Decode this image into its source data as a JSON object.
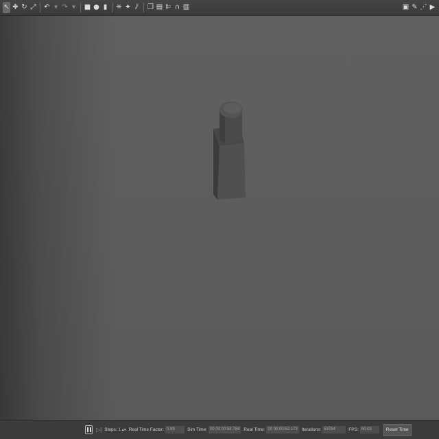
{
  "toolbar": {
    "left_tools": [
      {
        "name": "select-mode-icon",
        "glyph": "↖",
        "active": true
      },
      {
        "name": "translate-mode-icon",
        "glyph": "✥"
      },
      {
        "name": "rotate-mode-icon",
        "glyph": "↻"
      },
      {
        "name": "scale-mode-icon",
        "glyph": "⤢"
      }
    ],
    "history_tools": [
      {
        "name": "undo-icon",
        "glyph": "↶"
      },
      {
        "name": "undo-dropdown-icon",
        "glyph": "▾",
        "dim": true
      },
      {
        "name": "redo-icon",
        "glyph": "↷",
        "dim": true
      },
      {
        "name": "redo-dropdown-icon",
        "glyph": "▾",
        "dim": true
      }
    ],
    "shape_tools": [
      {
        "name": "box-shape-icon",
        "glyph": "■"
      },
      {
        "name": "sphere-shape-icon",
        "glyph": "●"
      },
      {
        "name": "cylinder-shape-icon",
        "glyph": "▮"
      }
    ],
    "light_tools": [
      {
        "name": "point-light-icon",
        "glyph": "✳"
      },
      {
        "name": "spot-light-icon",
        "glyph": "✦"
      },
      {
        "name": "directional-light-icon",
        "glyph": "⫽"
      }
    ],
    "edit_tools": [
      {
        "name": "copy-icon",
        "glyph": "❐"
      },
      {
        "name": "paste-icon",
        "glyph": "▤"
      },
      {
        "name": "align-icon",
        "glyph": "⊫"
      },
      {
        "name": "snap-icon",
        "glyph": "∩"
      },
      {
        "name": "change-view-icon",
        "glyph": "▥"
      }
    ],
    "right_tools": [
      {
        "name": "screenshot-icon",
        "glyph": "▣"
      },
      {
        "name": "log-icon",
        "glyph": "✎"
      },
      {
        "name": "plot-icon",
        "glyph": "⋰"
      },
      {
        "name": "video-record-icon",
        "glyph": "▶"
      }
    ]
  },
  "status": {
    "steps_label": "Steps:",
    "steps_value": "1",
    "rtf_label": "Real Time Factor:",
    "rtf_value": "0.99",
    "sim_time_label": "Sim Time:",
    "sim_time_value": "00 00:00:53.784",
    "real_time_label": "Real Time:",
    "real_time_value": "00 00:00:52.173",
    "iterations_label": "Iterations:",
    "iterations_value": "53784",
    "fps_label": "FPS:",
    "fps_value": "60.03",
    "reset_label": "Reset Time"
  },
  "colors": {
    "background": "#5a5a5a",
    "toolbar": "#3f3f3f",
    "model_front": "#505050",
    "model_side": "#3d3d3d"
  }
}
